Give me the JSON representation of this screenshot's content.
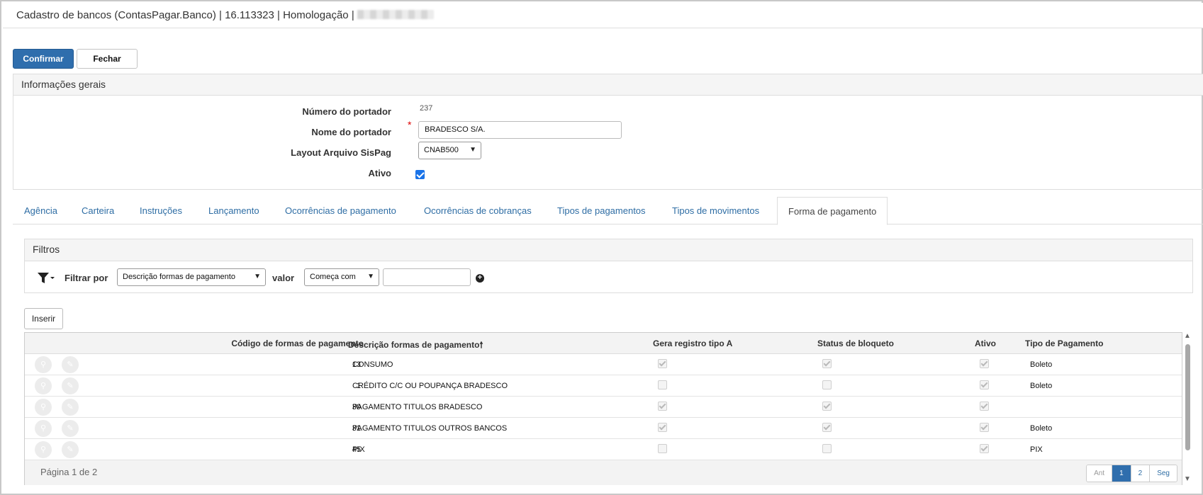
{
  "window": {
    "title": "Cadastro de bancos (ContasPagar.Banco) | 16.113323 | Homologação |"
  },
  "toolbar": {
    "confirm_label": "Confirmar",
    "close_label": "Fechar"
  },
  "general_info": {
    "heading": "Informações gerais",
    "portador_number_label": "Número do portador",
    "portador_number_value": "237",
    "portador_name_label": "Nome do portador",
    "portador_name_value": "BRADESCO S/A.",
    "required_mark": "*",
    "layout_label": "Layout Arquivo SisPag",
    "layout_value": "CNAB500",
    "active_label": "Ativo",
    "active_checked": true
  },
  "tabs": [
    {
      "label": "Agência"
    },
    {
      "label": "Carteira"
    },
    {
      "label": "Instruções"
    },
    {
      "label": "Lançamento"
    },
    {
      "label": "Ocorrências de pagamento"
    },
    {
      "label": "Ocorrências de cobranças"
    },
    {
      "label": "Tipos de pagamentos"
    },
    {
      "label": "Tipos de movimentos"
    },
    {
      "label": "Forma de pagamento",
      "active": true
    }
  ],
  "filters": {
    "heading": "Filtros",
    "filter_by_label": "Filtrar por",
    "filter_field_value": "Descrição formas de pagamento",
    "value_label": "valor",
    "operator_value": "Começa com",
    "value_input": ""
  },
  "grid": {
    "insert_label": "Inserir",
    "columns": {
      "code": "Código de formas de pagamento",
      "description": "Descrição formas de pagamento",
      "sort_indicator": "🠕",
      "gera_registro": "Gera registro tipo A",
      "status_bloqueto": "Status de bloqueto",
      "ativo": "Ativo",
      "tipo_pagamento": "Tipo de Pagamento"
    },
    "rows": [
      {
        "code": "13",
        "description": "CONSUMO",
        "gera_registro": true,
        "status_bloqueto": true,
        "ativo": true,
        "tipo": "Boleto"
      },
      {
        "code": "1",
        "description": "CRÉDITO C/C OU POUPANÇA BRADESCO",
        "gera_registro": false,
        "status_bloqueto": false,
        "ativo": true,
        "tipo": "Boleto"
      },
      {
        "code": "30",
        "description": "PAGAMENTO TITULOS BRADESCO",
        "gera_registro": true,
        "status_bloqueto": true,
        "ativo": true,
        "tipo": ""
      },
      {
        "code": "31",
        "description": "PAGAMENTO TITULOS OUTROS BANCOS",
        "gera_registro": true,
        "status_bloqueto": true,
        "ativo": true,
        "tipo": "Boleto"
      },
      {
        "code": "45",
        "description": "PIX",
        "gera_registro": false,
        "status_bloqueto": false,
        "ativo": true,
        "tipo": "PIX"
      }
    ],
    "page_info": "Página 1 de 2",
    "pager": {
      "prev": "Ant",
      "pages": [
        "1",
        "2"
      ],
      "next": "Seg",
      "current": "1"
    }
  }
}
